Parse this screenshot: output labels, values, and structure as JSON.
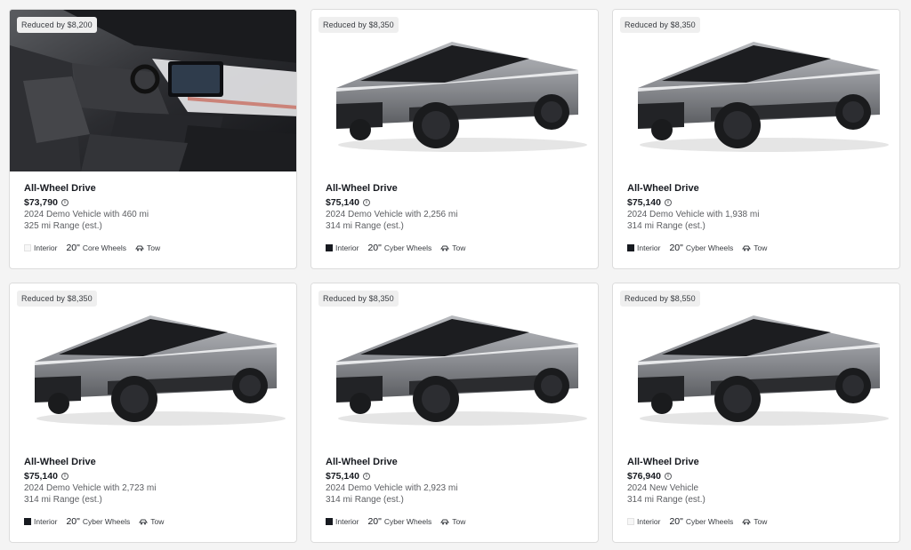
{
  "cards": [
    {
      "badge": "Reduced by $8,200",
      "image": "interior",
      "title": "All-Wheel Drive",
      "price": "$73,790",
      "desc1": "2024 Demo Vehicle with 460 mi",
      "desc2": "325 mi Range (est.)",
      "interior_label": "Interior",
      "interior_color": "#f7f7f7",
      "wheel_size": "20\"",
      "wheel_label": "Core Wheels",
      "tow_label": "Tow",
      "tow_icon": "tow-icon",
      "info_icon": "info-icon"
    },
    {
      "badge": "Reduced by $8,350",
      "image": "cybertruck",
      "title": "All-Wheel Drive",
      "price": "$75,140",
      "desc1": "2024 Demo Vehicle with 2,256 mi",
      "desc2": "314 mi Range (est.)",
      "interior_label": "Interior",
      "interior_color": "#171a20",
      "wheel_size": "20\"",
      "wheel_label": "Cyber Wheels",
      "tow_label": "Tow",
      "tow_icon": "tow-icon",
      "info_icon": "info-icon"
    },
    {
      "badge": "Reduced by $8,350",
      "image": "cybertruck",
      "title": "All-Wheel Drive",
      "price": "$75,140",
      "desc1": "2024 Demo Vehicle with 1,938 mi",
      "desc2": "314 mi Range (est.)",
      "interior_label": "Interior",
      "interior_color": "#171a20",
      "wheel_size": "20\"",
      "wheel_label": "Cyber Wheels",
      "tow_label": "Tow",
      "tow_icon": "tow-icon",
      "info_icon": "info-icon"
    },
    {
      "badge": "Reduced by $8,350",
      "image": "cybertruck",
      "title": "All-Wheel Drive",
      "price": "$75,140",
      "desc1": "2024 Demo Vehicle with 2,723 mi",
      "desc2": "314 mi Range (est.)",
      "interior_label": "Interior",
      "interior_color": "#171a20",
      "wheel_size": "20\"",
      "wheel_label": "Cyber Wheels",
      "tow_label": "Tow",
      "tow_icon": "tow-icon",
      "info_icon": "info-icon"
    },
    {
      "badge": "Reduced by $8,350",
      "image": "cybertruck",
      "title": "All-Wheel Drive",
      "price": "$75,140",
      "desc1": "2024 Demo Vehicle with 2,923 mi",
      "desc2": "314 mi Range (est.)",
      "interior_label": "Interior",
      "interior_color": "#171a20",
      "wheel_size": "20\"",
      "wheel_label": "Cyber Wheels",
      "tow_label": "Tow",
      "tow_icon": "tow-icon",
      "info_icon": "info-icon"
    },
    {
      "badge": "Reduced by $8,550",
      "image": "cybertruck",
      "title": "All-Wheel Drive",
      "price": "$76,940",
      "desc1": "2024 New Vehicle",
      "desc2": "314 mi Range (est.)",
      "interior_label": "Interior",
      "interior_color": "#f7f7f7",
      "wheel_size": "20\"",
      "wheel_label": "Cyber Wheels",
      "tow_label": "Tow",
      "tow_icon": "tow-icon",
      "info_icon": "info-icon"
    }
  ]
}
